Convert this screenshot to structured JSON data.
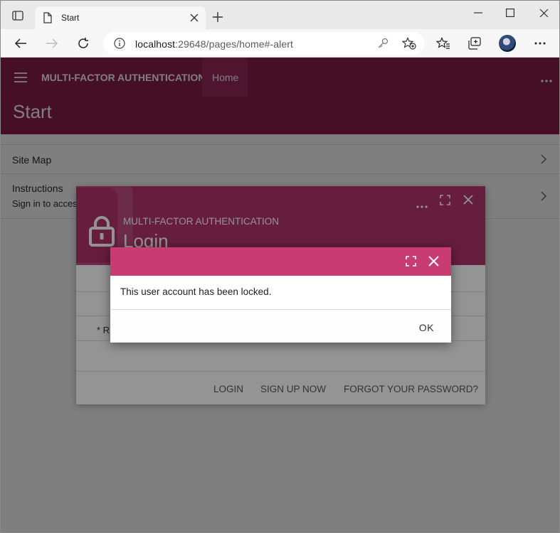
{
  "browser": {
    "tab_title": "Start",
    "url_host": "localhost",
    "url_rest": ":29648/pages/home#-alert"
  },
  "app": {
    "title": "MULTI-FACTOR AUTHENTICATION",
    "nav_home": "Home",
    "page_title": "Start",
    "list": [
      {
        "label": "Site Map"
      },
      {
        "label": "Instructions",
        "subtitle": "Sign in to access"
      }
    ]
  },
  "login_dialog": {
    "subtitle": "MULTI-FACTOR AUTHENTICATION",
    "title": "Login",
    "required_note": "* R",
    "buttons": {
      "login": "LOGIN",
      "signup": "SIGN UP NOW",
      "forgot": "FORGOT YOUR PASSWORD?"
    }
  },
  "alert_dialog": {
    "message": "This user account has been locked.",
    "ok_label": "OK"
  },
  "colors": {
    "app_bar": "#8e1e4c",
    "login_header": "#b2336a",
    "alert_header": "#c83c72"
  }
}
